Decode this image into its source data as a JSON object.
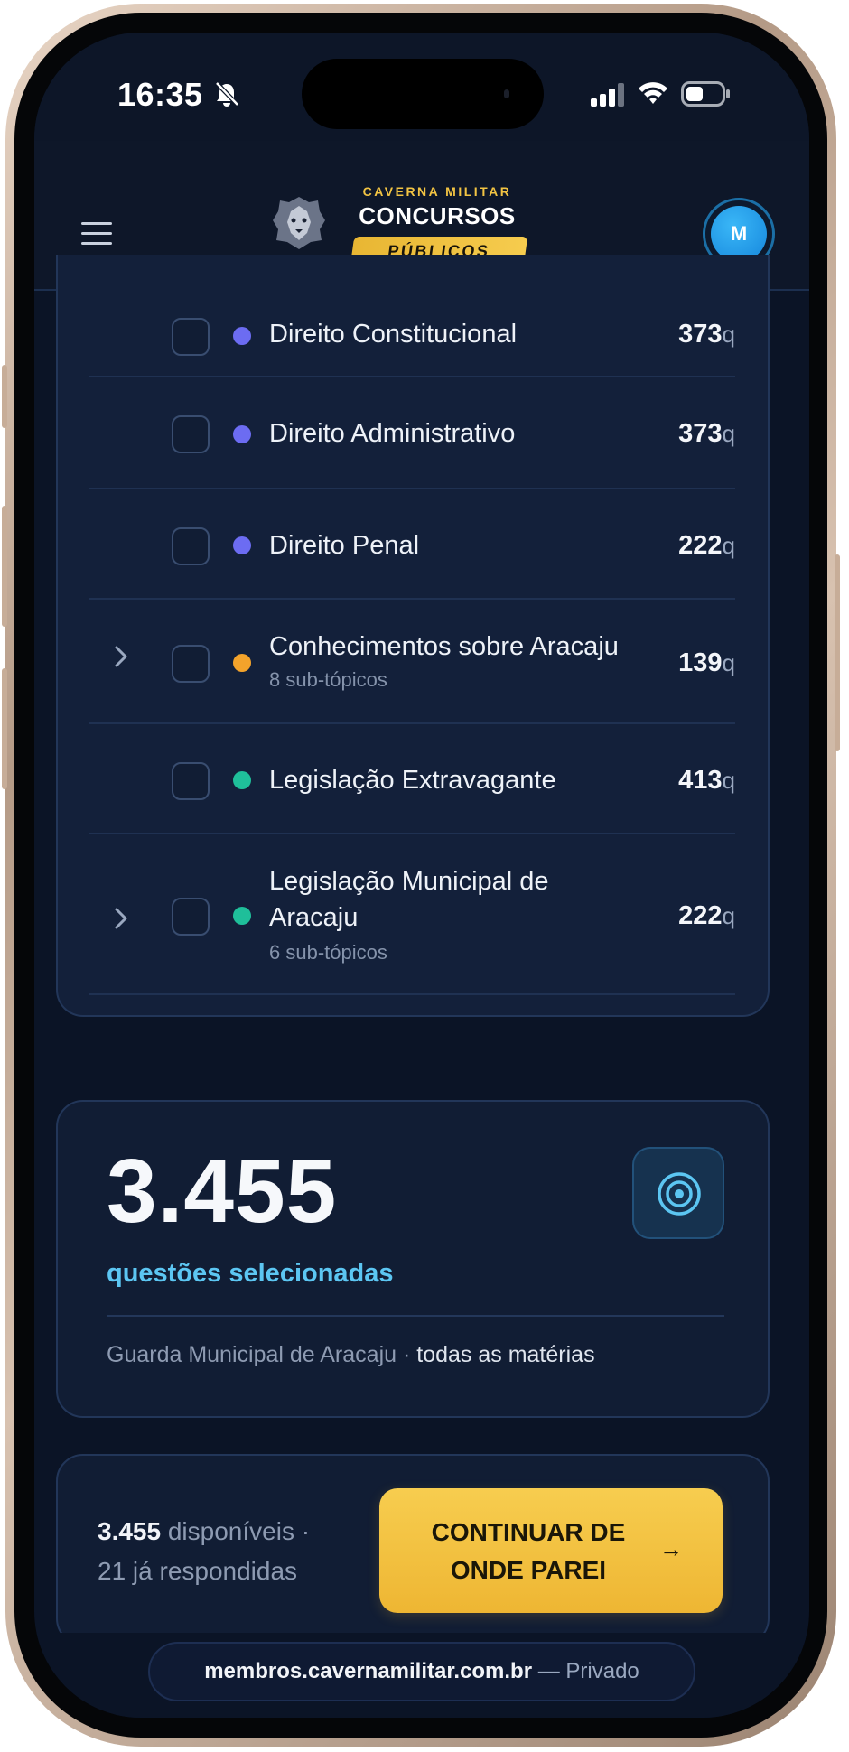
{
  "status_bar": {
    "time": "16:35"
  },
  "header": {
    "logo_top": "CAVERNA MILITAR",
    "logo_main": "CONCURSOS",
    "logo_pill": "PÚBLICOS",
    "avatar_initial": "M"
  },
  "topics": [
    {
      "name": "Direito Constitucional",
      "count": "373",
      "unit": "q",
      "dot_color": "#6c6cf2",
      "has_sub": false
    },
    {
      "name": "Direito Administrativo",
      "count": "373",
      "unit": "q",
      "dot_color": "#6c6cf2",
      "has_sub": false
    },
    {
      "name": "Direito Penal",
      "count": "222",
      "unit": "q",
      "dot_color": "#6c6cf2",
      "has_sub": false
    },
    {
      "name": "Conhecimentos sobre Aracaju",
      "sub": "8 sub-tópicos",
      "count": "139",
      "unit": "q",
      "dot_color": "#f3a32b",
      "has_sub": true
    },
    {
      "name": "Legislação Extravagante",
      "count": "413",
      "unit": "q",
      "dot_color": "#1fbf9a",
      "has_sub": false
    },
    {
      "name_line1": "Legislação Municipal de",
      "name_line2": "Aracaju",
      "sub": "6 sub-tópicos",
      "count": "222",
      "unit": "q",
      "dot_color": "#1fbf9a",
      "has_sub": true
    }
  ],
  "summary": {
    "number": "3.455",
    "label": "questões selecionadas",
    "meta_source": "Guarda Municipal de Aracaju",
    "meta_sep": " · ",
    "meta_scope": "todas as matérias"
  },
  "footer_card": {
    "available_count": "3.455",
    "available_text": " disponíveis ·",
    "answered_text": "21 já respondidas",
    "cta_line1": "CONTINUAR DE",
    "cta_line2": "ONDE PAREI",
    "cta_arrow": "→"
  },
  "url_bar": {
    "host": "membros.cavernamilitar.com.br",
    "separator": " — ",
    "mode": "Privado"
  }
}
